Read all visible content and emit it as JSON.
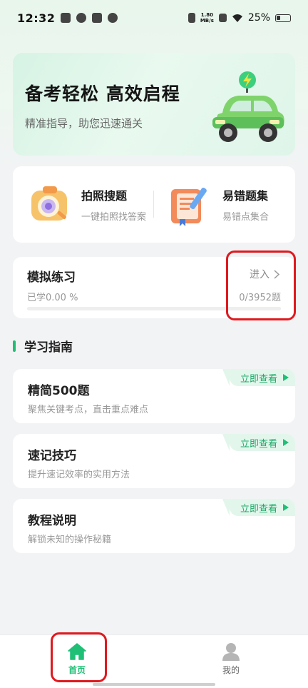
{
  "status_bar": {
    "time": "12:32",
    "speed_top": "1.80",
    "speed_bottom": "MB/s",
    "battery": "25%"
  },
  "banner": {
    "title": "备考轻松  高效启程",
    "subtitle": "精准指导，助您迅速通关"
  },
  "tools": [
    {
      "title": "拍照搜题",
      "subtitle": "一键拍照找答案",
      "icon": "camera-search-icon"
    },
    {
      "title": "易错题集",
      "subtitle": "易错点集合",
      "icon": "mistake-book-icon"
    }
  ],
  "practice": {
    "title": "模拟练习",
    "learned": "已学0.00 %",
    "enter_label": "进入",
    "count": "0/3952题",
    "progress": 0.0
  },
  "section": {
    "title": "学习指南"
  },
  "guides": [
    {
      "title": "精简500题",
      "subtitle": "聚焦关键考点，直击重点难点",
      "badge": "立即查看"
    },
    {
      "title": "速记技巧",
      "subtitle": "提升速记效率的实用方法",
      "badge": "立即查看"
    },
    {
      "title": "教程说明",
      "subtitle": "解锁未知的操作秘籍",
      "badge": "立即查看"
    }
  ],
  "bottom_nav": {
    "home_label": "首页",
    "profile_label": "我的"
  },
  "colors": {
    "accent": "#1fbf76",
    "highlight": "#e0191f"
  }
}
